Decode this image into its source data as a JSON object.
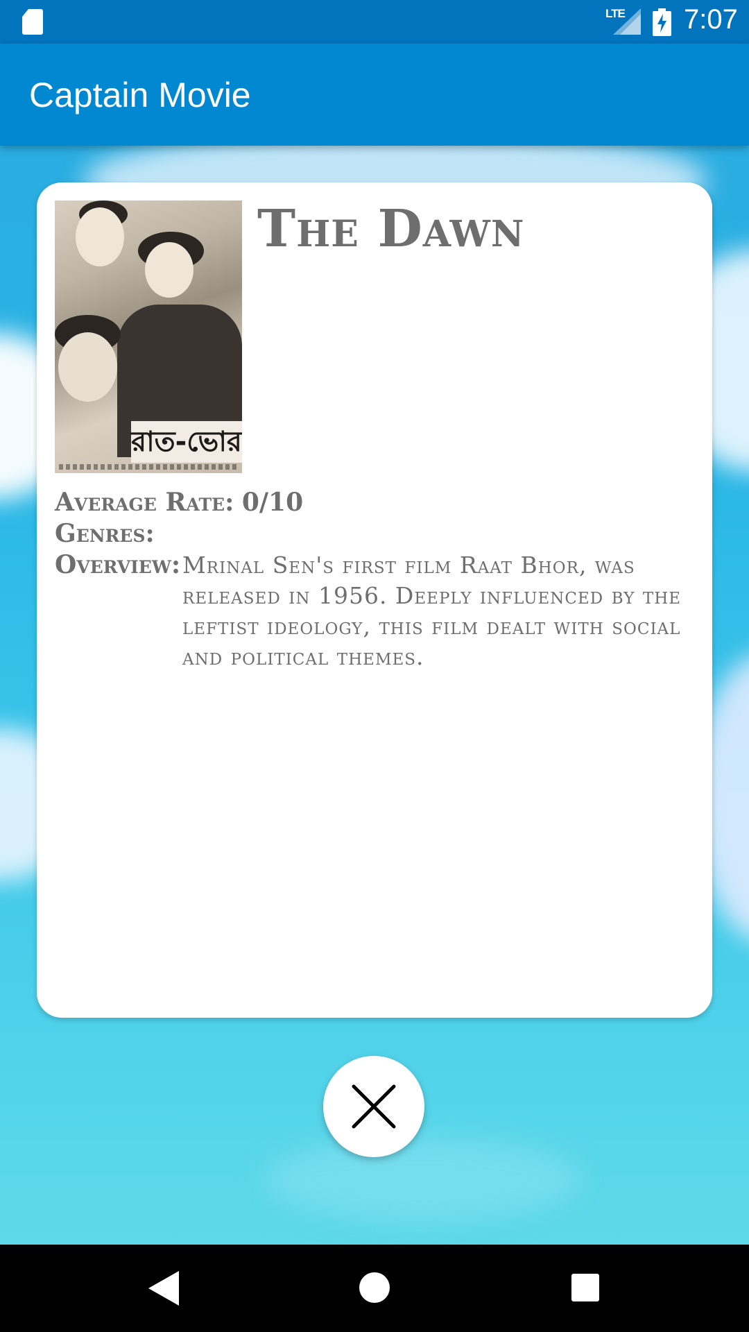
{
  "status_bar": {
    "network": "LTE",
    "time": "7:07",
    "icons": [
      "sd-card-icon",
      "signal-icon",
      "battery-charging-icon"
    ]
  },
  "app_bar": {
    "title": "Captain Movie"
  },
  "movie": {
    "title": "The Dawn",
    "poster_text": "রাত-ভোর",
    "average_rate_label": "Average Rate:",
    "average_rate_value": "0/10",
    "genres_label": "Genres:",
    "genres_value": "",
    "overview_label": "Overview:",
    "overview_text": "Mrinal Sen's first film Raat Bhor, was released in 1956. Deeply influenced by the leftist ideology, this film dealt with social and political themes."
  },
  "actions": {
    "close_icon": "close-icon"
  },
  "nav_bar": {
    "icons": [
      "back-icon",
      "home-icon",
      "recents-icon"
    ]
  },
  "colors": {
    "status_bar": "#0274be",
    "app_bar": "#0288d1",
    "card_background": "#ffffff",
    "text_gray": "#6e6e6e"
  }
}
